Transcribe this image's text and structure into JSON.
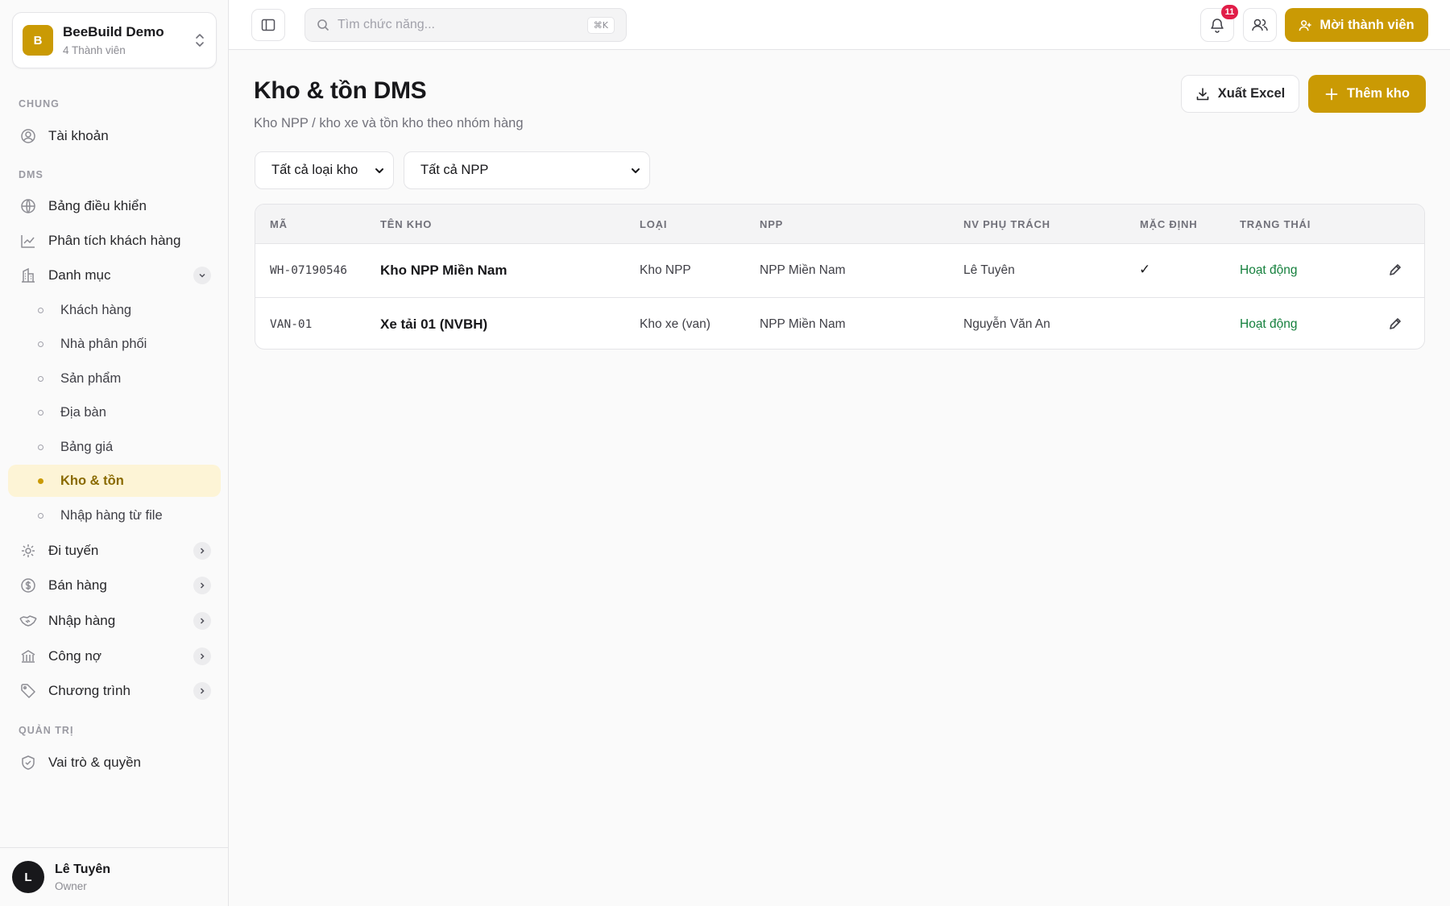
{
  "workspace": {
    "logo_letter": "B",
    "name": "BeeBuild Demo",
    "members": "4 Thành viên"
  },
  "sidebar": {
    "section_general": "CHUNG",
    "account": "Tài khoản",
    "section_dms": "DMS",
    "dashboard": "Bảng điều khiển",
    "customer_analytics": "Phân tích khách hàng",
    "catalog": "Danh mục",
    "catalog_items": [
      "Khách hàng",
      "Nhà phân phối",
      "Sản phẩm",
      "Địa bàn",
      "Bảng giá",
      "Kho & tồn",
      "Nhập hàng từ file"
    ],
    "routing": "Đi tuyến",
    "sales": "Bán hàng",
    "purchasing": "Nhập hàng",
    "debt": "Công nợ",
    "programs": "Chương trình",
    "section_admin": "QUẢN TRỊ",
    "roles": "Vai trò & quyền"
  },
  "user": {
    "initial": "L",
    "name": "Lê Tuyên",
    "role": "Owner"
  },
  "topbar": {
    "search_placeholder": "Tìm chức năng...",
    "search_shortcut": "⌘K",
    "notification_count": "11",
    "invite_label": "Mời thành viên"
  },
  "page": {
    "title": "Kho & tồn DMS",
    "subtitle": "Kho NPP / kho xe và tồn kho theo nhóm hàng",
    "export_label": "Xuất Excel",
    "add_label": "Thêm kho"
  },
  "filters": {
    "warehouse_type": "Tất cả loại kho",
    "distributor": "Tất cả NPP"
  },
  "table": {
    "headers": [
      "MÃ",
      "TÊN KHO",
      "LOẠI",
      "NPP",
      "NV PHỤ TRÁCH",
      "MẶC ĐỊNH",
      "TRẠNG THÁI"
    ],
    "rows": [
      {
        "code": "WH-07190546",
        "name": "Kho NPP Miền Nam",
        "type": "Kho NPP",
        "npp": "NPP Miền Nam",
        "staff": "Lê Tuyên",
        "default": "✓",
        "status": "Hoạt động"
      },
      {
        "code": "VAN-01",
        "name": "Xe tải 01 (NVBH)",
        "type": "Kho xe (van)",
        "npp": "NPP Miền Nam",
        "staff": "Nguyễn Văn An",
        "default": "",
        "status": "Hoạt động"
      }
    ]
  },
  "colors": {
    "accent": "#ca9a04",
    "active_bg": "#fdf4d6",
    "status_green": "#15803d",
    "badge_red": "#e11d48"
  }
}
